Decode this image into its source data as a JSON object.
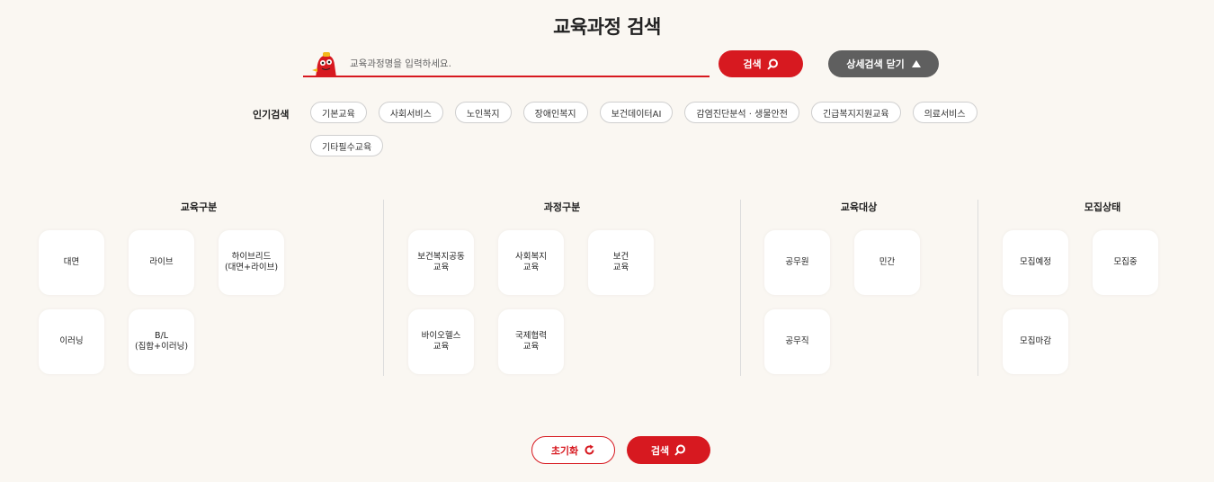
{
  "page_title": "교육과정 검색",
  "search": {
    "placeholder": "교육과정명을 입력하세요.",
    "search_label": "검색",
    "detail_toggle_label": "상세검색 닫기"
  },
  "popular": {
    "label": "인기검색",
    "tags": [
      "기본교육",
      "사회서비스",
      "노인복지",
      "장애인복지",
      "보건데이터AI",
      "감염진단분석 · 생물안전",
      "긴급복지지원교육",
      "의료서비스",
      "기타필수교육"
    ]
  },
  "filters": {
    "edu_type": {
      "title": "교육구분",
      "options": [
        {
          "line1": "대면",
          "line2": ""
        },
        {
          "line1": "라이브",
          "line2": ""
        },
        {
          "line1": "하이브리드",
          "line2": "(대면+라이브)"
        },
        {
          "line1": "이러닝",
          "line2": ""
        },
        {
          "line1": "B/L",
          "line2": "(집합+이러닝)"
        }
      ]
    },
    "course_type": {
      "title": "과정구분",
      "options": [
        {
          "line1": "보건복지공동",
          "line2": "교육"
        },
        {
          "line1": "사회복지",
          "line2": "교육"
        },
        {
          "line1": "보건",
          "line2": "교육"
        },
        {
          "line1": "바이오헬스",
          "line2": "교육"
        },
        {
          "line1": "국제협력",
          "line2": "교육"
        }
      ]
    },
    "target": {
      "title": "교육대상",
      "options": [
        {
          "line1": "공무원",
          "line2": ""
        },
        {
          "line1": "민간",
          "line2": ""
        },
        {
          "line1": "공무직",
          "line2": ""
        }
      ]
    },
    "status": {
      "title": "모집상태",
      "options": [
        {
          "line1": "모집예정",
          "line2": ""
        },
        {
          "line1": "모집중",
          "line2": ""
        },
        {
          "line1": "모집마감",
          "line2": ""
        }
      ]
    }
  },
  "actions": {
    "reset_label": "초기화",
    "search_label": "검색"
  },
  "colors": {
    "accent": "#d71920",
    "dark_button": "#5f5f5f",
    "background": "#faf7f2"
  },
  "icons": {
    "search": "search-icon",
    "collapse": "triangle-up-icon",
    "reset": "refresh-icon",
    "mascot": "mascot-icon"
  }
}
